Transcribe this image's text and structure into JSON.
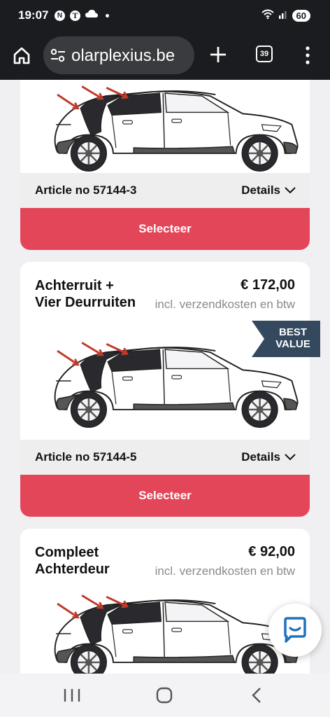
{
  "status_bar": {
    "time": "19:07",
    "battery": "60",
    "icons": [
      "n-news-icon",
      "t-news-icon",
      "cloud-icon",
      "dot-icon",
      "wifi-icon",
      "signal-icon",
      "battery-icon"
    ]
  },
  "browser": {
    "url": "olarplexius.be",
    "tab_count": "39"
  },
  "products": [
    {
      "article": "Article no 57144-3",
      "details": "Details",
      "select": "Selecteer"
    },
    {
      "title": "Achterruit + Vier Deurruiten",
      "price": "€ 172,00",
      "price_note": "incl. verzendkosten en btw",
      "badge": "BEST VALUE",
      "article": "Article no 57144-5",
      "details": "Details",
      "select": "Selecteer"
    },
    {
      "title": "Compleet Achterdeur",
      "price": "€ 92,00",
      "price_note": "incl. verzendkosten en btw"
    }
  ],
  "colors": {
    "accent": "#e34658",
    "badge": "#34495e",
    "arrow": "#c0392b",
    "tint": "#2a2a2e",
    "chat": "#1e73be"
  }
}
